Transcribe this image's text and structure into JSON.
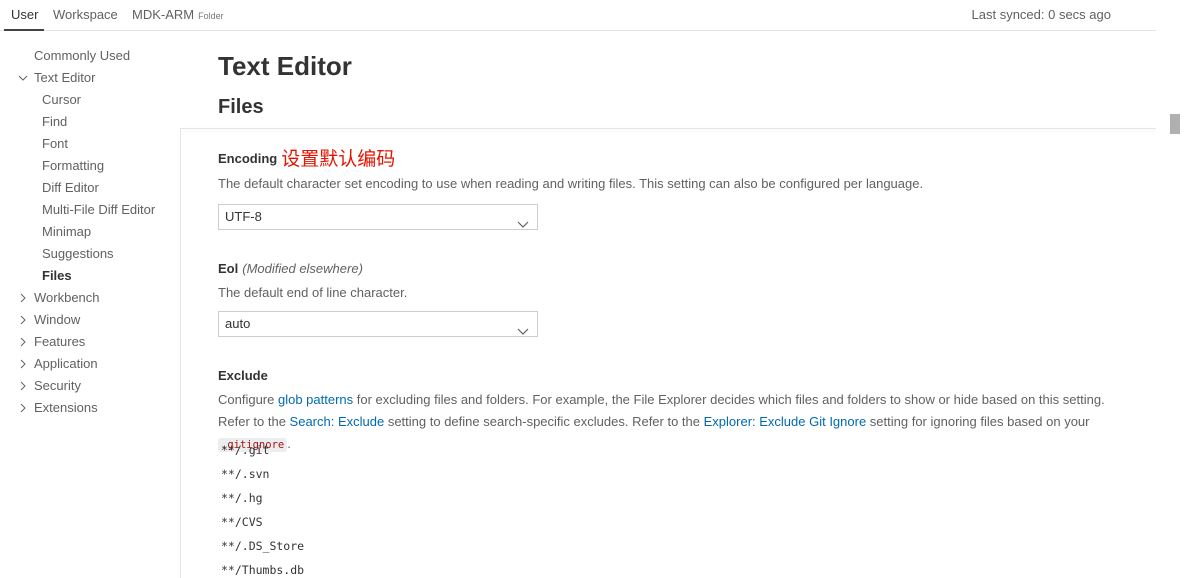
{
  "scope_tabs": [
    {
      "label": "User"
    },
    {
      "label": "Workspace"
    },
    {
      "label": "MDK-ARM",
      "sub": "Folder"
    }
  ],
  "sync_status": "Last synced: 0 secs ago",
  "toc": {
    "commonly_used": "Commonly Used",
    "text_editor": "Text Editor",
    "text_editor_children": [
      "Cursor",
      "Find",
      "Font",
      "Formatting",
      "Diff Editor",
      "Multi-File Diff Editor",
      "Minimap",
      "Suggestions",
      "Files"
    ],
    "groups": [
      "Workbench",
      "Window",
      "Features",
      "Application",
      "Security",
      "Extensions"
    ]
  },
  "page_title": "Text Editor",
  "section_title": "Files",
  "settings": {
    "encoding": {
      "title": "Encoding",
      "annotation": "设置默认编码",
      "description": "The default character set encoding to use when reading and writing files. This setting can also be configured per language.",
      "value": "UTF-8"
    },
    "eol": {
      "title": "Eol",
      "modified": "(Modified elsewhere)",
      "description": "The default end of line character.",
      "value": "auto"
    },
    "exclude": {
      "title": "Exclude",
      "desc_1": "Configure ",
      "link_glob": "glob patterns",
      "desc_2": " for excluding files and folders. For example, the File Explorer decides which files and folders to show or hide based on this setting. Refer to the ",
      "link_search": "Search: Exclude",
      "desc_3": " setting to define search-specific excludes. Refer to the ",
      "link_explorer": "Explorer: Exclude Git Ignore",
      "desc_4": " setting for ignoring files based on your ",
      "code": ".gitignore",
      "desc_5": ".",
      "patterns": [
        "**/.git",
        "**/.svn",
        "**/.hg",
        "**/CVS",
        "**/.DS_Store",
        "**/Thumbs.db"
      ]
    }
  },
  "colors": {
    "link": "#006ab1",
    "annotation": "#e51400",
    "code_text": "#a31515"
  },
  "icons": {
    "tree_expanded": "chevron-down-icon",
    "tree_collapsed": "chevron-right-icon",
    "select": "chevron-down-icon"
  }
}
